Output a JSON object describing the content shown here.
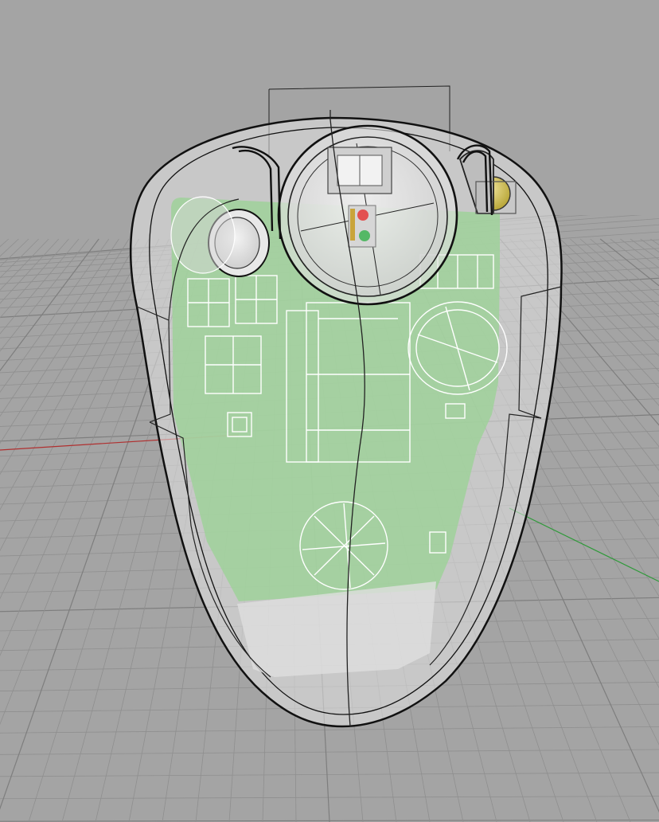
{
  "viewport": {
    "background_color": "#a4a4a4",
    "grid_color": "#8f8f8f",
    "grid_major_color": "#7e7e7e",
    "x_axis_color": "#b03030",
    "y_axis_color": "#2f9a3a",
    "shell_fill": "#e6e6e6",
    "shell_edge_color": "#111111",
    "pcb_color": "#9fd19a",
    "wire_color": "#ffffff"
  },
  "model": {
    "icons": [
      "trackball-ball",
      "side-button",
      "coin-cell-battery",
      "pcb-board",
      "status-led"
    ],
    "led_red": "#e35050",
    "led_green": "#54b866",
    "button_yellow": "#d6c64a"
  }
}
